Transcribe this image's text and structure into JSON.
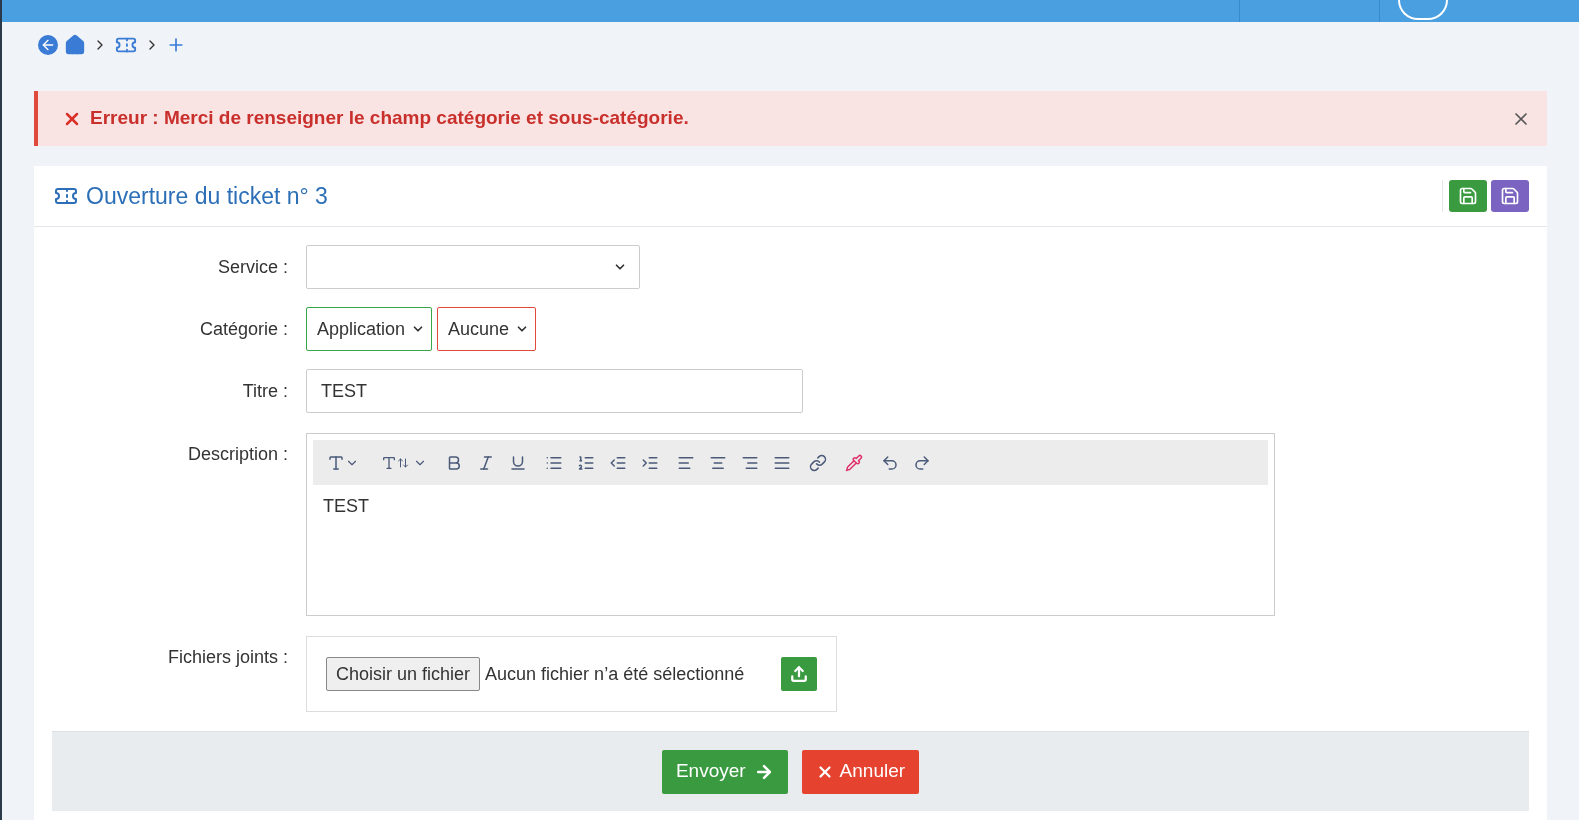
{
  "alert": {
    "label": "Erreur :",
    "message": "Merci de renseigner le champ catégorie et sous-catégorie."
  },
  "card": {
    "title": "Ouverture du ticket n° 3"
  },
  "form": {
    "service": {
      "label": "Service :"
    },
    "categorie": {
      "label": "Catégorie :",
      "selects": [
        {
          "value": "Application",
          "invalid": false
        },
        {
          "value": "Aucune",
          "invalid": true
        }
      ]
    },
    "titre": {
      "label": "Titre :",
      "value": "TEST"
    },
    "description": {
      "label": "Description :",
      "value": "TEST"
    },
    "fichiers": {
      "label": "Fichiers joints :",
      "button": "Choisir un fichier",
      "status": "Aucun fichier n’a été sélectionné"
    }
  },
  "footer": {
    "buttons": [
      {
        "kind": "submit",
        "label": "Envoyer"
      },
      {
        "kind": "cancel",
        "label": "Annuler"
      }
    ]
  }
}
